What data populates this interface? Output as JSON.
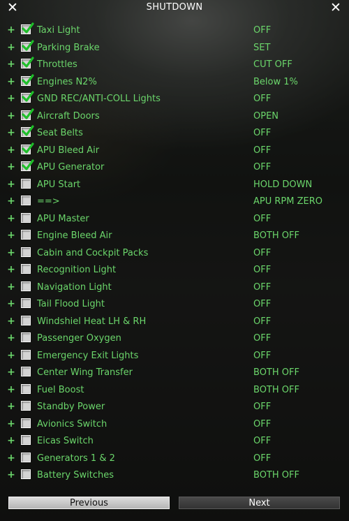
{
  "window": {
    "title": "SHUTDOWN",
    "close_left": "✕",
    "close_right": "✕"
  },
  "rows": [
    {
      "expand": "+",
      "label": "Taxi Light",
      "value": "OFF",
      "checked": true
    },
    {
      "expand": "+",
      "label": "Parking Brake",
      "value": "SET",
      "checked": true
    },
    {
      "expand": "+",
      "label": "Throttles",
      "value": "CUT OFF",
      "checked": true
    },
    {
      "expand": "+",
      "label": "Engines N2%",
      "value": "Below 1%",
      "checked": true
    },
    {
      "expand": "+",
      "label": "GND REC/ANTI-COLL Lights",
      "value": "OFF",
      "checked": true
    },
    {
      "expand": "+",
      "label": "Aircraft Doors",
      "value": "OPEN",
      "checked": true
    },
    {
      "expand": "+",
      "label": "Seat Belts",
      "value": "OFF",
      "checked": true
    },
    {
      "expand": "+",
      "label": "APU Bleed Air",
      "value": "OFF",
      "checked": true
    },
    {
      "expand": "+",
      "label": "APU Generator",
      "value": "OFF",
      "checked": true
    },
    {
      "expand": "+",
      "label": "APU Start",
      "value": "HOLD DOWN",
      "checked": false
    },
    {
      "expand": "+",
      "label": "==>",
      "value": "APU RPM ZERO",
      "checked": false
    },
    {
      "expand": "+",
      "label": "APU Master",
      "value": "OFF",
      "checked": false
    },
    {
      "expand": "+",
      "label": "Engine Bleed Air",
      "value": "BOTH OFF",
      "checked": false
    },
    {
      "expand": "+",
      "label": "Cabin and Cockpit Packs",
      "value": "OFF",
      "checked": false
    },
    {
      "expand": "+",
      "label": "Recognition Light",
      "value": "OFF",
      "checked": false
    },
    {
      "expand": "+",
      "label": "Navigation Light",
      "value": "OFF",
      "checked": false
    },
    {
      "expand": "+",
      "label": "Tail Flood Light",
      "value": "OFF",
      "checked": false
    },
    {
      "expand": "+",
      "label": "Windshiel Heat LH & RH",
      "value": "OFF",
      "checked": false
    },
    {
      "expand": "+",
      "label": "Passenger Oxygen",
      "value": "OFF",
      "checked": false
    },
    {
      "expand": "+",
      "label": "Emergency Exit Lights",
      "value": "OFF",
      "checked": false
    },
    {
      "expand": "+",
      "label": "Center Wing Transfer",
      "value": "BOTH OFF",
      "checked": false
    },
    {
      "expand": "+",
      "label": "Fuel Boost",
      "value": "BOTH OFF",
      "checked": false
    },
    {
      "expand": "+",
      "label": "Standby Power",
      "value": "OFF",
      "checked": false
    },
    {
      "expand": "+",
      "label": "Avionics Switch",
      "value": "OFF",
      "checked": false
    },
    {
      "expand": "+",
      "label": "Eicas Switch",
      "value": "OFF",
      "checked": false
    },
    {
      "expand": "+",
      "label": "Generators 1 & 2",
      "value": "OFF",
      "checked": false
    },
    {
      "expand": "+",
      "label": "Battery Switches",
      "value": "BOTH OFF",
      "checked": false
    }
  ],
  "buttons": {
    "previous": "Previous",
    "next": "Next"
  },
  "colors": {
    "text": "#6bd66b",
    "tick": "#2ecc2e",
    "title": "#ffffff"
  }
}
